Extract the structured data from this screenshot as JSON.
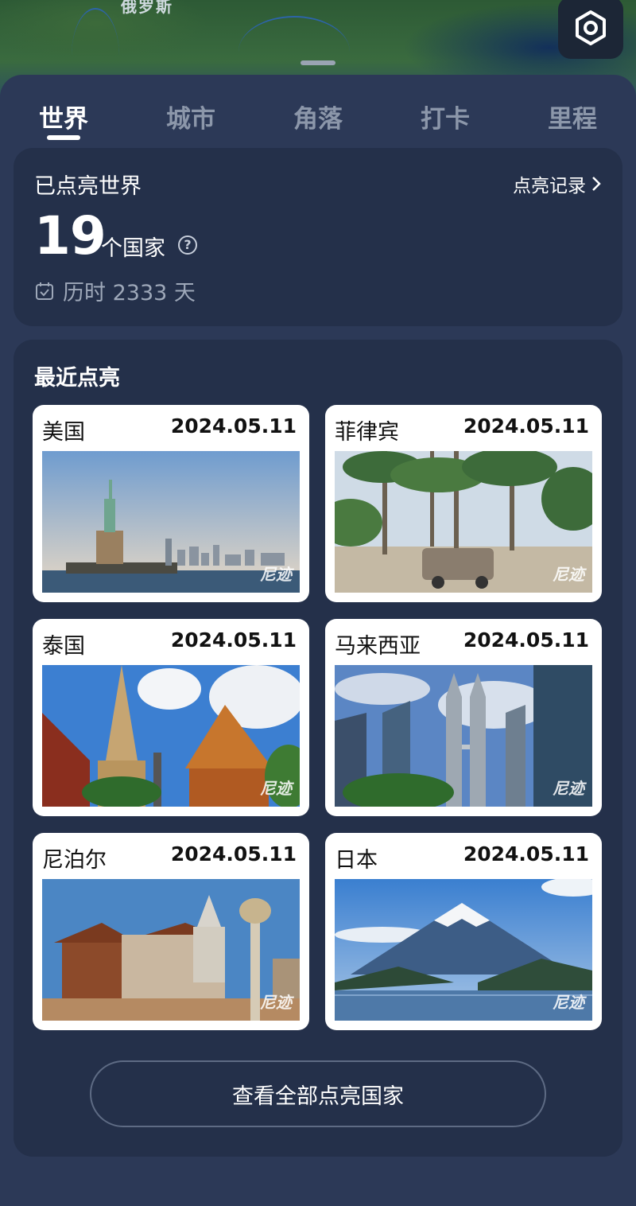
{
  "map": {
    "region_label": "俄罗斯"
  },
  "tabs": [
    {
      "label": "世界",
      "active": true
    },
    {
      "label": "城市",
      "active": false
    },
    {
      "label": "角落",
      "active": false
    },
    {
      "label": "打卡",
      "active": false
    },
    {
      "label": "里程",
      "active": false
    }
  ],
  "summary": {
    "title": "已点亮世界",
    "records_link": "点亮记录",
    "count": "19",
    "count_unit": "个国家",
    "help": "?",
    "duration": "历时 2333 天"
  },
  "recent": {
    "title": "最近点亮",
    "watermark": "尼迹",
    "items": [
      {
        "country": "美国",
        "date": "2024.05.11",
        "photo": "statue-of-liberty"
      },
      {
        "country": "菲律宾",
        "date": "2024.05.11",
        "photo": "palm-beach-jeepney"
      },
      {
        "country": "泰国",
        "date": "2024.05.11",
        "photo": "thai-temple"
      },
      {
        "country": "马来西亚",
        "date": "2024.05.11",
        "photo": "petronas-towers"
      },
      {
        "country": "尼泊尔",
        "date": "2024.05.11",
        "photo": "nepal-temple-square"
      },
      {
        "country": "日本",
        "date": "2024.05.11",
        "photo": "mount-fuji"
      }
    ],
    "view_all": "查看全部点亮国家"
  }
}
